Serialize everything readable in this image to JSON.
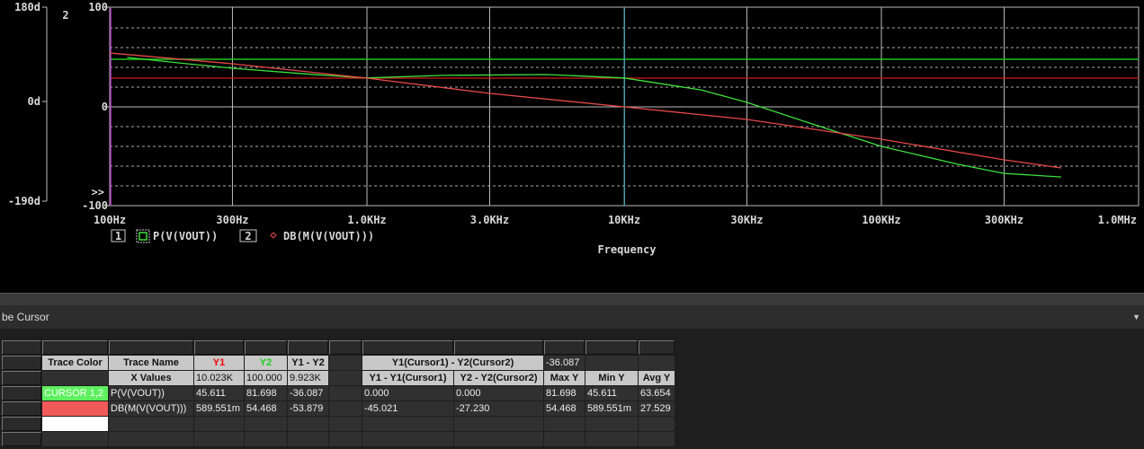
{
  "chart_data": {
    "type": "line",
    "xlabel": "Frequency",
    "xscale": "log",
    "xlim": [
      100,
      1000000
    ],
    "x_ticks": [
      "100Hz",
      "300Hz",
      "1.0KHz",
      "3.0KHz",
      "10KHz",
      "30KHz",
      "100KHz",
      "300KHz",
      "1.0MHz"
    ],
    "x_tick_values": [
      100,
      300,
      1000,
      3000,
      10000,
      30000,
      100000,
      300000,
      1000000
    ],
    "axes": [
      {
        "id": "1",
        "ylim": [
          -190,
          180
        ],
        "ticks": [
          "180d",
          "0d",
          "-190d"
        ],
        "tick_values": [
          180,
          0,
          -190
        ]
      },
      {
        "id": "2",
        "ylim": [
          -100,
          100
        ],
        "ticks": [
          "100",
          "0",
          "-100"
        ],
        "tick_values": [
          100,
          0,
          -100
        ]
      }
    ],
    "axis_marker": ">>",
    "axis2_label": "2",
    "series": [
      {
        "name": "P(V(VOUT))",
        "axis": "1",
        "color": "#3ee03e",
        "marker": "square",
        "legend_index": "1",
        "x": [
          117,
          200,
          300,
          600,
          1000,
          2000,
          5000,
          10000,
          20000,
          30000,
          50000,
          100000,
          200000,
          300000,
          500000
        ],
        "y": [
          84,
          72,
          63.5,
          52,
          45,
          50,
          51.5,
          45,
          22,
          -1.6,
          -37.5,
          -85.5,
          -120,
          -137,
          -144
        ]
      },
      {
        "name": "DB(M(V(VOUT)))",
        "axis": "2",
        "color": "#e84848",
        "marker": "diamond",
        "legend_index": "2",
        "x": [
          100,
          300,
          1000,
          3000,
          10000,
          30000,
          100000,
          300000,
          500000
        ],
        "y": [
          54.3,
          43.4,
          29,
          13.6,
          0,
          -12.7,
          -32.6,
          -53.4,
          -61.5
        ]
      }
    ],
    "cursors": {
      "x1": 100,
      "x2": 10023,
      "y_green": 81.698,
      "y_red_db": 29
    }
  },
  "panel": {
    "title": "be Cursor",
    "dropdown": "▼"
  },
  "table": {
    "rows": [
      [
        {
          "c": "btn"
        },
        {
          "c": "btn"
        },
        {
          "c": "btn"
        },
        {
          "c": "btn"
        },
        {
          "c": "btn"
        },
        {
          "c": "btn"
        },
        {
          "c": "btn"
        },
        {
          "c": "btn"
        },
        {
          "c": "btn"
        },
        {
          "c": "btn"
        },
        {
          "c": "btn"
        },
        {
          "c": "btn"
        }
      ],
      [
        {
          "c": "btn"
        },
        {
          "c": "h",
          "t": "Trace Color"
        },
        {
          "c": "h",
          "t": "Trace Name"
        },
        {
          "c": "h red",
          "t": "Y1"
        },
        {
          "c": "h grn",
          "t": "Y2"
        },
        {
          "c": "h",
          "t": "Y1 - Y2"
        },
        {
          "c": ""
        },
        {
          "c": "h",
          "t": "Y1(Cursor1) - Y2(Cursor2)",
          "span": 2
        },
        {
          "c": "",
          "t": "-36.087"
        },
        {
          "c": ""
        },
        {
          "c": ""
        }
      ],
      [
        {
          "c": "btn"
        },
        {
          "c": ""
        },
        {
          "c": "h",
          "t": "X Values"
        },
        {
          "c": "hl",
          "t": "10.023K"
        },
        {
          "c": "hl",
          "t": "100.000"
        },
        {
          "c": "hl",
          "t": "9.923K"
        },
        {
          "c": ""
        },
        {
          "c": "h",
          "t": "Y1 - Y1(Cursor1)"
        },
        {
          "c": "h",
          "t": "Y2 - Y2(Cursor2)"
        },
        {
          "c": "h",
          "t": "Max Y"
        },
        {
          "c": "h",
          "t": "Min Y"
        },
        {
          "c": "h",
          "t": "Avg Y"
        }
      ],
      [
        {
          "c": "btn"
        },
        {
          "c": "c-green",
          "t": "CURSOR 1,2"
        },
        {
          "c": "",
          "t": "P(V(VOUT))"
        },
        {
          "c": "",
          "t": "45.611"
        },
        {
          "c": "",
          "t": "81.698"
        },
        {
          "c": "",
          "t": "-36.087"
        },
        {
          "c": ""
        },
        {
          "c": "",
          "t": "0.000"
        },
        {
          "c": "",
          "t": "0.000"
        },
        {
          "c": "",
          "t": "81.698"
        },
        {
          "c": "",
          "t": "45.611"
        },
        {
          "c": "",
          "t": "63.654"
        }
      ],
      [
        {
          "c": "btn"
        },
        {
          "c": "c-red"
        },
        {
          "c": "",
          "t": "DB(M(V(VOUT)))"
        },
        {
          "c": "",
          "t": "589.551m"
        },
        {
          "c": "",
          "t": "54.468"
        },
        {
          "c": "",
          "t": "-53.879"
        },
        {
          "c": ""
        },
        {
          "c": "",
          "t": "-45.021"
        },
        {
          "c": "",
          "t": "-27.230"
        },
        {
          "c": "",
          "t": "54.468"
        },
        {
          "c": "",
          "t": "589.551m"
        },
        {
          "c": "",
          "t": "27.529"
        }
      ],
      [
        {
          "c": "btn"
        },
        {
          "c": "c-white"
        },
        {
          "c": ""
        },
        {
          "c": ""
        },
        {
          "c": ""
        },
        {
          "c": ""
        },
        {
          "c": ""
        },
        {
          "c": ""
        },
        {
          "c": ""
        },
        {
          "c": ""
        },
        {
          "c": ""
        },
        {
          "c": ""
        }
      ],
      [
        {
          "c": "btn"
        },
        {
          "c": ""
        },
        {
          "c": ""
        },
        {
          "c": ""
        },
        {
          "c": ""
        },
        {
          "c": ""
        },
        {
          "c": ""
        },
        {
          "c": ""
        },
        {
          "c": ""
        },
        {
          "c": ""
        },
        {
          "c": ""
        },
        {
          "c": ""
        }
      ]
    ]
  }
}
